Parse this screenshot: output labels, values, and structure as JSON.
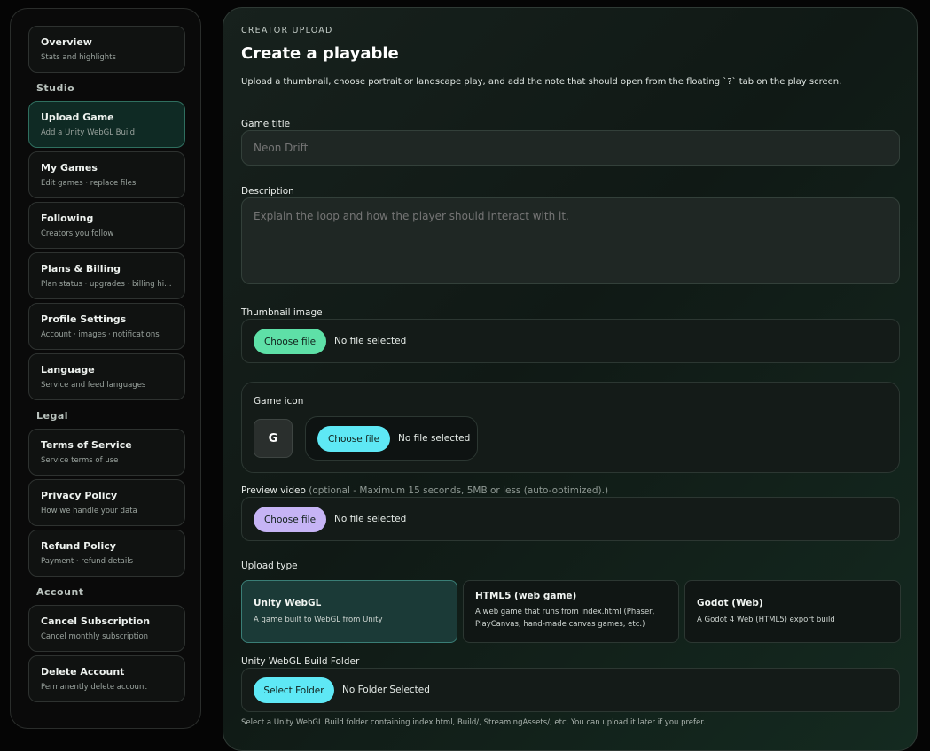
{
  "sidebar": {
    "top_items": [
      {
        "title": "Overview",
        "subtitle": "Stats and highlights"
      }
    ],
    "studio": {
      "title": "Studio",
      "items": [
        {
          "title": "Upload Game",
          "subtitle": "Add a Unity WebGL Build"
        },
        {
          "title": "My Games",
          "subtitle": "Edit games · replace files"
        },
        {
          "title": "Following",
          "subtitle": "Creators you follow"
        },
        {
          "title": "Plans & Billing",
          "subtitle": "Plan status · upgrades · billing his..."
        },
        {
          "title": "Profile Settings",
          "subtitle": "Account · images · notifications"
        },
        {
          "title": "Language",
          "subtitle": "Service and feed languages"
        }
      ]
    },
    "legal": {
      "title": "Legal",
      "items": [
        {
          "title": "Terms of Service",
          "subtitle": "Service terms of use"
        },
        {
          "title": "Privacy Policy",
          "subtitle": "How we handle your data"
        },
        {
          "title": "Refund Policy",
          "subtitle": "Payment · refund details"
        }
      ]
    },
    "account": {
      "title": "Account",
      "items": [
        {
          "title": "Cancel Subscription",
          "subtitle": "Cancel monthly subscription"
        },
        {
          "title": "Delete Account",
          "subtitle": "Permanently delete account"
        }
      ]
    }
  },
  "main": {
    "eyebrow": "CREATOR UPLOAD",
    "title": "Create a playable",
    "description": "Upload a thumbnail, choose portrait or landscape play, and add the note that should open from the floating `?` tab on the play screen.",
    "game_title": {
      "label": "Game title",
      "placeholder": "Neon Drift"
    },
    "desc_field": {
      "label": "Description",
      "placeholder": "Explain the loop and how the player should interact with it."
    },
    "thumbnail": {
      "label": "Thumbnail image",
      "button": "Choose file",
      "status": "No file selected",
      "color": "#5ee0a7"
    },
    "game_icon": {
      "label": "Game icon",
      "avatar_letter": "G",
      "button": "Choose file",
      "status": "No file selected",
      "color": "#5ee8f5"
    },
    "preview_video": {
      "label": "Preview video",
      "note": "(optional - Maximum 15 seconds, 5MB or less (auto-optimized).)",
      "button": "Choose file",
      "status": "No file selected",
      "color": "#c6b4f5"
    },
    "upload_type": {
      "label": "Upload type",
      "options": [
        {
          "title": "Unity WebGL",
          "desc": "A game built to WebGL from Unity",
          "selected": true
        },
        {
          "title": "HTML5 (web game)",
          "desc": "A web game that runs from index.html (Phaser, PlayCanvas, hand-made canvas games, etc.)",
          "selected": false
        },
        {
          "title": "Godot (Web)",
          "desc": "A Godot 4 Web (HTML5) export build",
          "selected": false
        }
      ]
    },
    "build_folder": {
      "label": "Unity WebGL Build Folder",
      "button": "Select Folder",
      "status": "No Folder Selected",
      "hint": "Select a Unity WebGL Build folder containing index.html, Build/, StreamingAssets/, etc. You can upload it later if you prefer.",
      "color": "#5ee8f5"
    }
  }
}
